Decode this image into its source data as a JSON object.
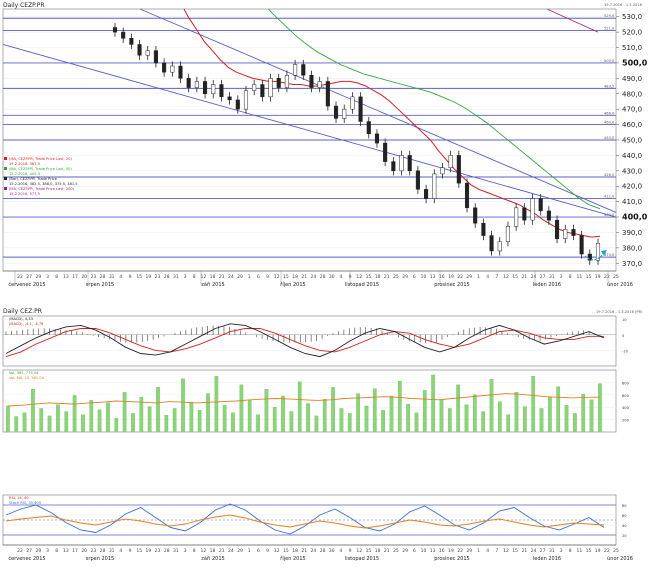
{
  "charts": {
    "price": {
      "title": "Daily CEZP.PR",
      "top_right_info": "19.7.2016 - 1.3.2016",
      "y_ticks": [
        "530,0",
        "520,0",
        "510,0",
        "500,0",
        "490,0",
        "480,0",
        "470,0",
        "460,0",
        "450,0",
        "440,0",
        "430,0",
        "420,0",
        "410,0",
        "400,0",
        "390,0",
        "380,0",
        "370,0"
      ],
      "legend": [
        {
          "text": "(MA, CEZP.PR, Trade Price Last, 20)",
          "color": "#d42020"
        },
        {
          "text": "15.2.2016, 387,5",
          "color": "#d42020"
        },
        {
          "text": "(MA, CEZP.PR, Trade Price Last, 50)",
          "color": "#3aa53a"
        },
        {
          "text": "15.2.2016, 405,4",
          "color": "#3aa53a"
        },
        {
          "text": "(Bar), CEZP.PR, Trade Price",
          "color": "#222222"
        },
        {
          "text": "15.2.2016, 382,5, 388,0, 375,5, 381,5",
          "color": "#222222"
        },
        {
          "text": "(MA, CEZP.PR, Trade Price Last, 200)",
          "color": "#a0207a"
        },
        {
          "text": "15.2.2016, 577,5",
          "color": "#a0207a"
        }
      ],
      "hline_tags": [
        "529,0",
        "521,0",
        "500,0",
        "483,5",
        "466,0",
        "460,0",
        "450,0",
        "426,0",
        "412,0",
        "400,0",
        "374,0"
      ]
    },
    "macd": {
      "title": "Daily CEZ.PR",
      "top_right_info": "19.7.2016 - 1.3.2016 (PR)",
      "legend": [
        {
          "text": "(MACD), 4,33",
          "color": "#222222"
        },
        {
          "text": "(MACD), -4,1, -4,78",
          "color": "#d42020"
        }
      ]
    },
    "volume": {
      "legend": [
        {
          "text": "Vol, 385, 779,04",
          "color": "#3aa53a"
        },
        {
          "text": "Vol, MA, 20, 561,04",
          "color": "#e08020"
        }
      ]
    },
    "rsi": {
      "legend": [
        {
          "text": "RSI, 14, 40",
          "color": "#d42020"
        },
        {
          "text": "Stoch RSI, 35,409",
          "color": "#3a6fd0"
        }
      ]
    }
  },
  "chart_data": [
    {
      "type": "candlestick",
      "title": "Daily CEZP.PR",
      "ylim": [
        365,
        535
      ],
      "grid": true,
      "x_day_labels": [
        "22",
        "27",
        "29",
        "3",
        "8",
        "13",
        "17",
        "20",
        "23",
        "28",
        "31",
        "4",
        "9",
        "15",
        "19",
        "23",
        "28",
        "31",
        "3",
        "8",
        "12",
        "18",
        "21",
        "24",
        "29",
        "1",
        "6",
        "9",
        "12",
        "15",
        "18",
        "21",
        "24",
        "28",
        "30",
        "4",
        "9",
        "12",
        "15",
        "18",
        "21",
        "25",
        "29",
        "6",
        "10",
        "13",
        "16",
        "19",
        "22",
        "29",
        "1",
        "4",
        "7",
        "12",
        "15",
        "21",
        "24",
        "27",
        "31",
        "3",
        "8",
        "11",
        "15",
        "19",
        "22",
        "25"
      ],
      "month_labels": [
        "červenec 2015",
        "srpen 2015",
        "září 2015",
        "říjen 2015",
        "listopad 2015",
        "prosinec 2015",
        "leden 2016",
        "únor 2016"
      ],
      "horizontal_levels": [
        529,
        521,
        500,
        483.5,
        466,
        460,
        450,
        426,
        412,
        400,
        374
      ],
      "series": [
        {
          "name": "(Bar), CEZP.PR, Trade Price",
          "close": [
            520,
            516,
            512,
            505,
            508,
            500,
            494,
            498,
            490,
            484,
            488,
            480,
            486,
            478,
            476,
            470,
            482,
            486,
            478,
            490,
            484,
            492,
            499,
            492,
            484,
            488,
            472,
            464,
            470,
            478,
            462,
            454,
            448,
            436,
            430,
            440,
            430,
            418,
            412,
            428,
            432,
            440,
            422,
            406,
            396,
            388,
            378,
            384,
            394,
            406,
            398,
            412,
            404,
            398,
            386,
            392,
            388,
            376,
            372,
            383
          ]
        },
        {
          "name": "(MA, CEZP.PR, Trade Price Last, 20)",
          "values": [
            540,
            530,
            522,
            514,
            508,
            502,
            497,
            494,
            492,
            490,
            489,
            488,
            488,
            487,
            486,
            486,
            485,
            485,
            486,
            487,
            488,
            488,
            487,
            485,
            482,
            479,
            475,
            470,
            465,
            460,
            455,
            450,
            443,
            437,
            431,
            426,
            421,
            418,
            416,
            414,
            412,
            410,
            408,
            405,
            402,
            398,
            395,
            392,
            390,
            389,
            388,
            387,
            387.5
          ]
        },
        {
          "name": "(MA, CEZP.PR, Trade Price Last, 50)",
          "values": [
            548,
            540,
            532,
            525,
            518,
            512,
            507,
            503,
            499,
            496,
            493,
            491,
            489,
            487,
            485,
            483,
            481,
            478,
            475,
            471,
            466,
            461,
            455,
            449,
            443,
            437,
            431,
            425,
            419,
            413,
            408,
            405.4
          ]
        },
        {
          "name": "(MA, CEZP.PR, Trade Price Last, 200)",
          "values": [
            540,
            535,
            530,
            525,
            520
          ]
        }
      ]
    },
    {
      "type": "line",
      "title": "MACD",
      "ylim": [
        -20,
        12
      ],
      "series": [
        {
          "name": "(MACD), 4,33",
          "values": [
            -12,
            -7,
            -2,
            2,
            5,
            6,
            3,
            -2,
            -8,
            -12,
            -13,
            -11,
            -6,
            -1,
            4,
            7,
            6,
            2,
            -3,
            -8,
            -12,
            -14,
            -10,
            -4,
            1,
            4,
            2,
            -3,
            -8,
            -11,
            -8,
            -2,
            3,
            6,
            3,
            -2,
            -6,
            -4,
            -1,
            2,
            -2
          ]
        },
        {
          "name": "(MACD), -4,1, -4,78",
          "values": [
            -14,
            -11,
            -6,
            -2,
            2,
            4,
            4,
            1,
            -3,
            -7,
            -10,
            -11,
            -9,
            -6,
            -2,
            2,
            4,
            4,
            1,
            -3,
            -7,
            -10,
            -11,
            -8,
            -4,
            0,
            2,
            1,
            -3,
            -6,
            -8,
            -6,
            -2,
            2,
            3,
            1,
            -2,
            -3,
            -3,
            -1,
            -1
          ]
        },
        {
          "name": "histogram",
          "values": [
            2,
            3,
            4,
            4,
            3,
            2,
            -1,
            -3,
            -5,
            -5,
            -3,
            0,
            3,
            5,
            6,
            5,
            2,
            -2,
            -4,
            -5,
            -5,
            -4,
            1,
            4,
            5,
            4,
            0,
            -4,
            -5,
            -5,
            0,
            4,
            5,
            4,
            0,
            -3,
            -4,
            -1,
            2,
            3,
            -1
          ]
        }
      ]
    },
    {
      "type": "bar",
      "title": "Volume",
      "ylim": [
        0,
        1000
      ],
      "series": [
        {
          "name": "Vol, 385, 779,04",
          "values": [
            420,
            250,
            310,
            690,
            380,
            260,
            440,
            330,
            590,
            280,
            510,
            360,
            470,
            220,
            640,
            300,
            560,
            410,
            720,
            270,
            380,
            860,
            480,
            350,
            620,
            900,
            430,
            310,
            760,
            520,
            280,
            690,
            400,
            580,
            330,
            810,
            460,
            260,
            530,
            720,
            380,
            300,
            620,
            420,
            700,
            350,
            580,
            820,
            450,
            310,
            670,
            920,
            520,
            380,
            760,
            440,
            600,
            330,
            850,
            490,
            280,
            640,
            410,
            900,
            380,
            560,
            730,
            430,
            300,
            610,
            520,
            780
          ]
        },
        {
          "name": "Vol, MA, 20, 561,04",
          "values": [
            420,
            430,
            450,
            470,
            460,
            450,
            470,
            480,
            500,
            490,
            480,
            470,
            490,
            480,
            470,
            480,
            490,
            500,
            520,
            530,
            540,
            530,
            520,
            510,
            520,
            540,
            550,
            560,
            570,
            560,
            540,
            530,
            520,
            540,
            560,
            580,
            600,
            620,
            610,
            590,
            570,
            560,
            550,
            560,
            561
          ]
        }
      ]
    },
    {
      "type": "line",
      "title": "RSI",
      "ylim": [
        0,
        100
      ],
      "series": [
        {
          "name": "RSI, 14, 40",
          "values": [
            48,
            52,
            55,
            58,
            50,
            44,
            40,
            46,
            52,
            48,
            42,
            38,
            42,
            50,
            56,
            60,
            54,
            46,
            40,
            36,
            42,
            48,
            44,
            38,
            34,
            38,
            44,
            50,
            46,
            40,
            38,
            42,
            48,
            52,
            46,
            40,
            36,
            40,
            44,
            42,
            40
          ]
        },
        {
          "name": "Stoch RSI, 35,409",
          "values": [
            60,
            72,
            80,
            65,
            45,
            30,
            25,
            40,
            62,
            75,
            55,
            35,
            28,
            45,
            70,
            82,
            70,
            48,
            30,
            22,
            38,
            60,
            72,
            55,
            35,
            28,
            42,
            66,
            78,
            60,
            40,
            30,
            45,
            68,
            75,
            55,
            38,
            30,
            42,
            55,
            35
          ]
        }
      ]
    }
  ]
}
